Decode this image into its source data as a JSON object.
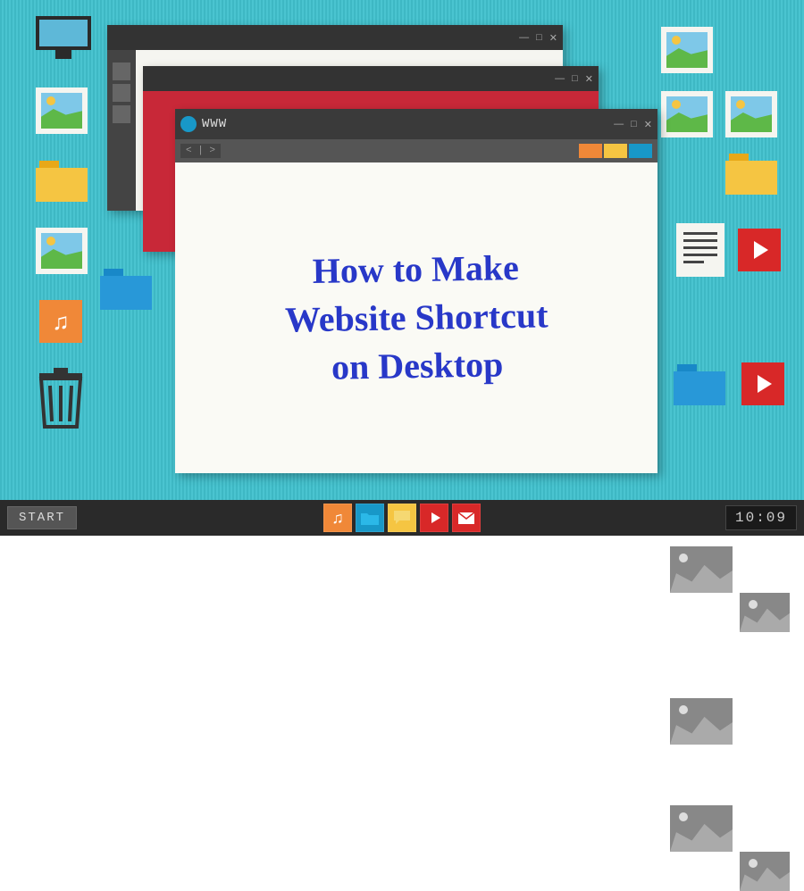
{
  "taskbar": {
    "start": "START",
    "clock": "10:09"
  },
  "browser": {
    "url_label": "WWW",
    "nav": "< | >",
    "minimize": "—",
    "maximize": "□",
    "close": "✕"
  },
  "headline": "How to Make\nWebsite Shortcut\non Desktop",
  "colors": {
    "chip_orange": "#f08838",
    "chip_yellow": "#f5c542",
    "chip_blue": "#1898c8"
  }
}
